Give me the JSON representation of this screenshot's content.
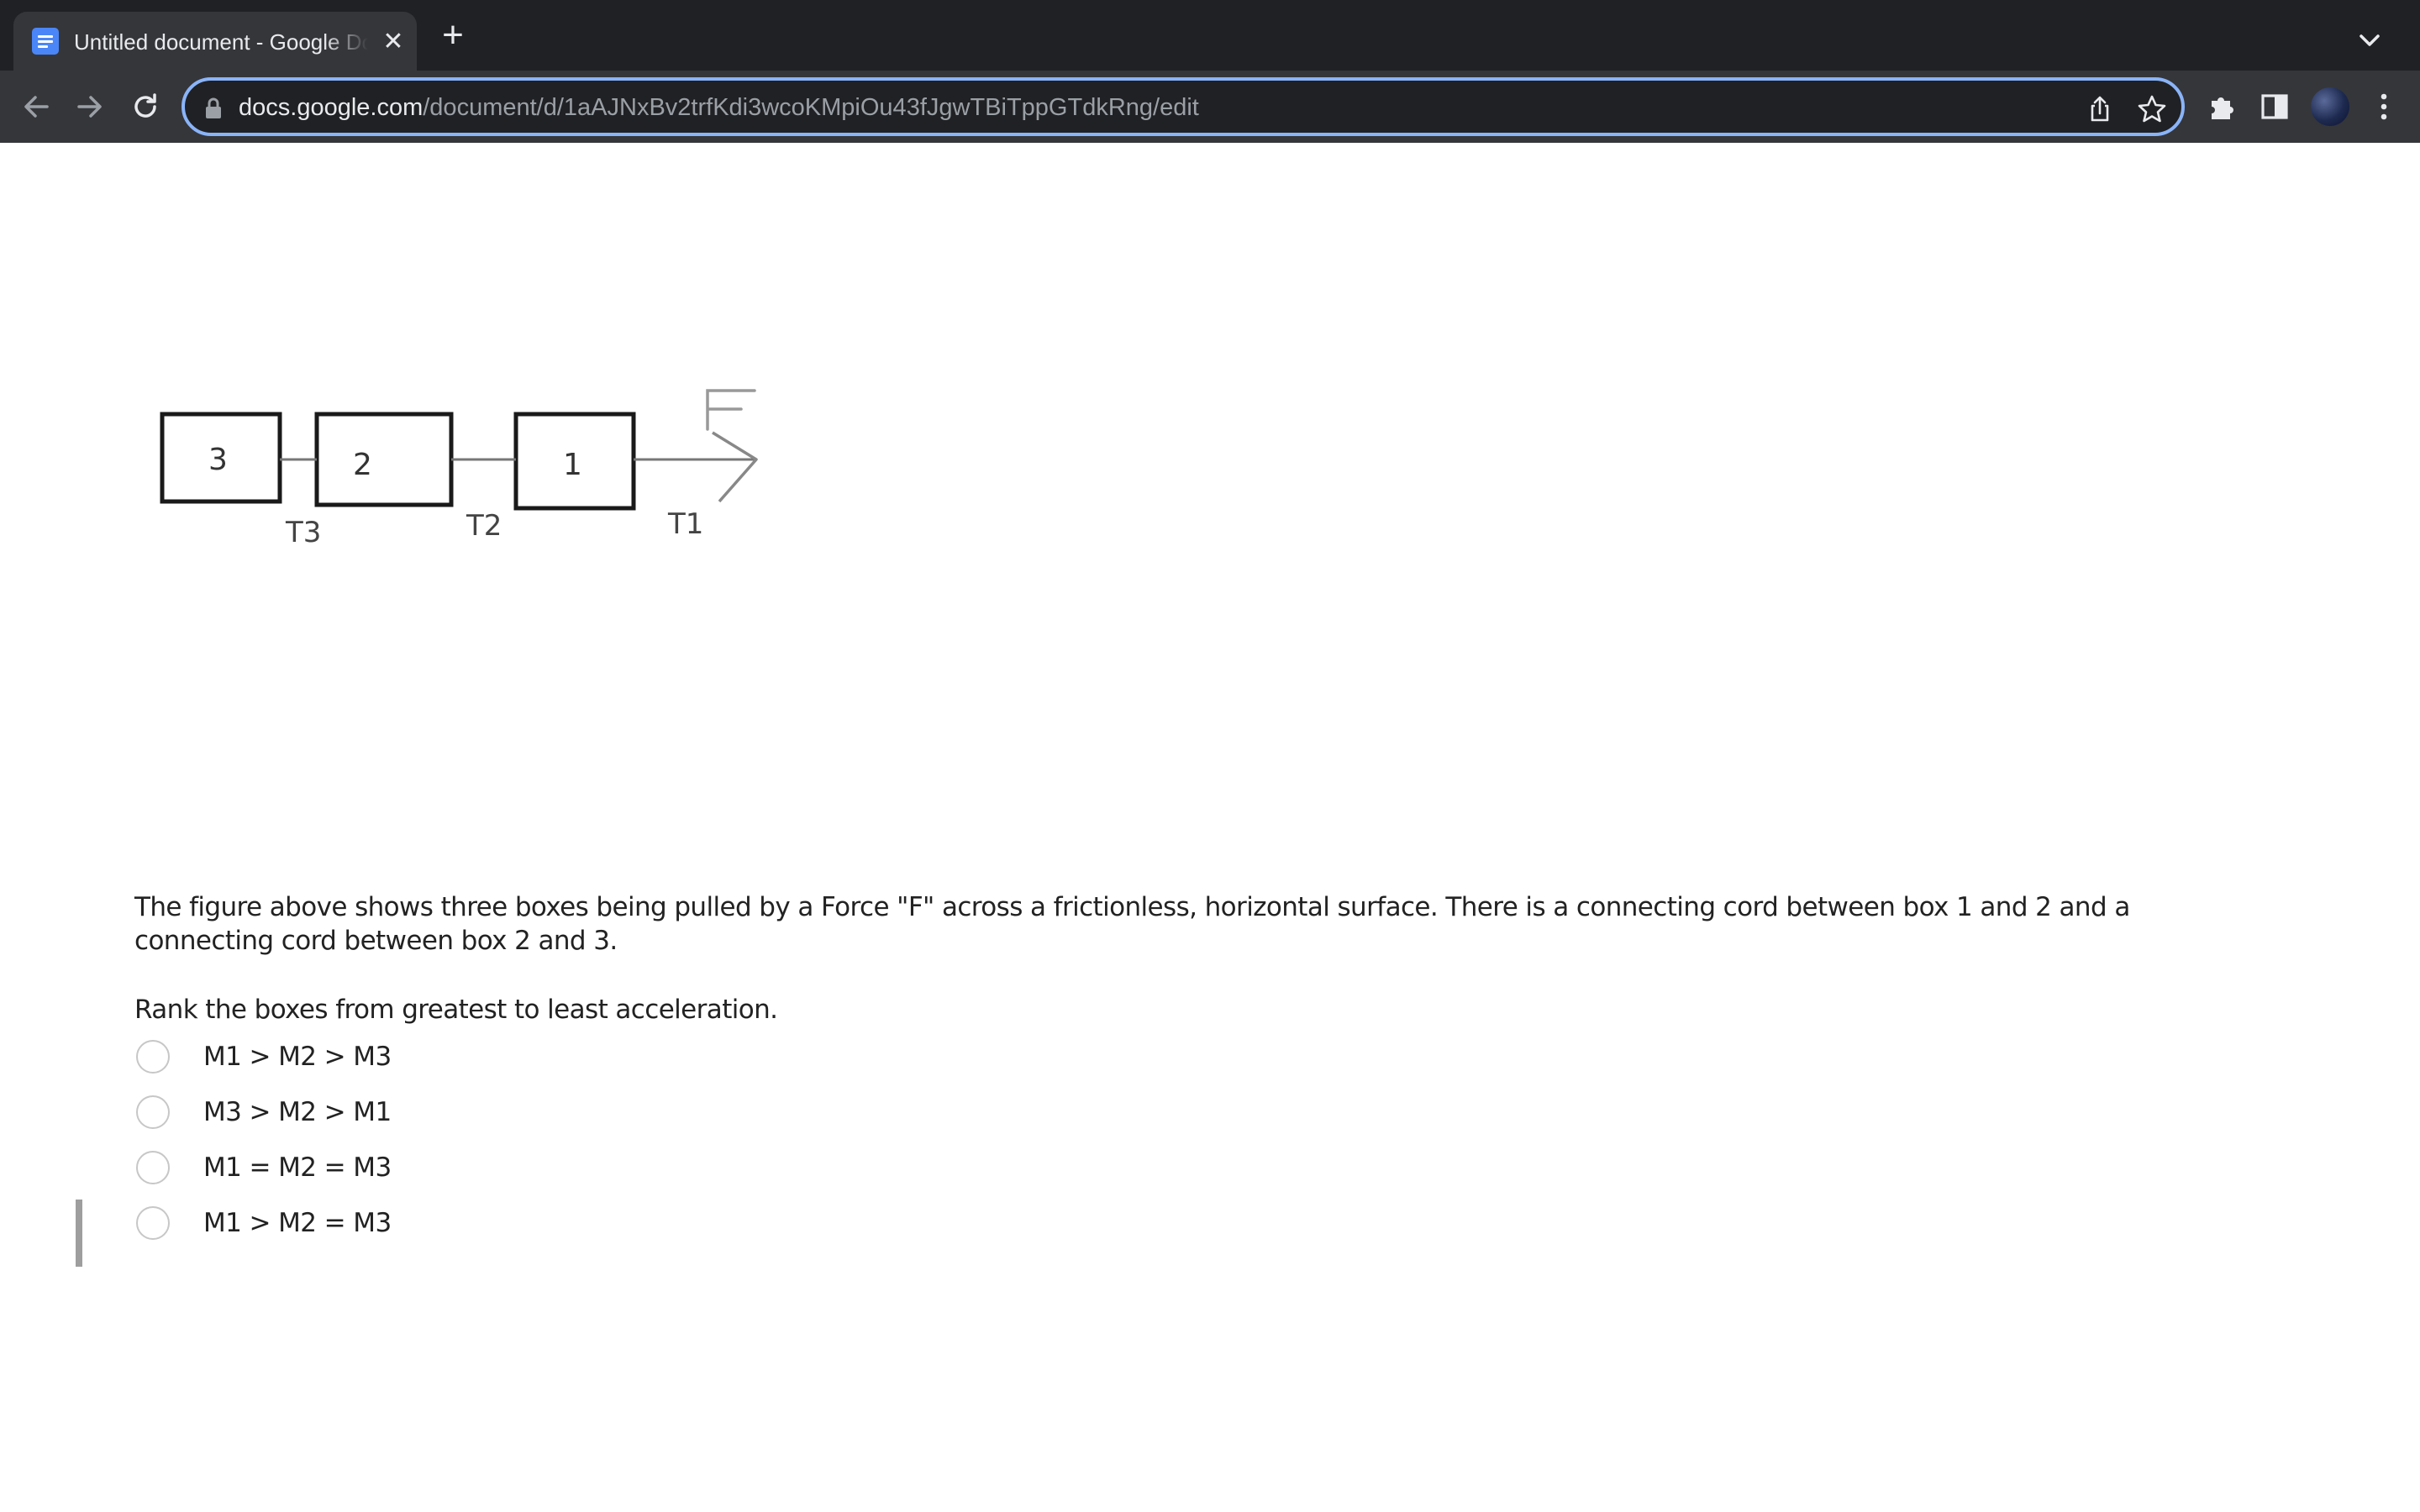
{
  "browser": {
    "tab": {
      "title": "Untitled document - Google Docs",
      "favicon_icon": "google-docs-icon",
      "close_glyph": "✕"
    },
    "new_tab_glyph": "+",
    "url": {
      "host": "docs.google.com",
      "path": "/document/d/1aAJNxBv2trfKdi3wcoKMpiOu43fJgwTBiTppGTdkRng/edit"
    },
    "accent_color": "#8ab4f8",
    "chrome_color": "#35363a"
  },
  "document": {
    "figure": {
      "boxes": [
        "3",
        "2",
        "1"
      ],
      "tensions": [
        "T3",
        "T2",
        "T1"
      ],
      "force_label": "F"
    },
    "question": "The figure above shows three boxes being pulled by a Force \"F\" across a frictionless, horizontal surface.  There is a connecting cord between box 1 and 2 and a connecting cord between box 2 and 3.",
    "prompt": "Rank the boxes from greatest to least acceleration.",
    "options": [
      "M1 > M2 > M3",
      "M3 > M2 > M1",
      "M1 = M2 = M3",
      "M1 > M2 = M3"
    ]
  }
}
